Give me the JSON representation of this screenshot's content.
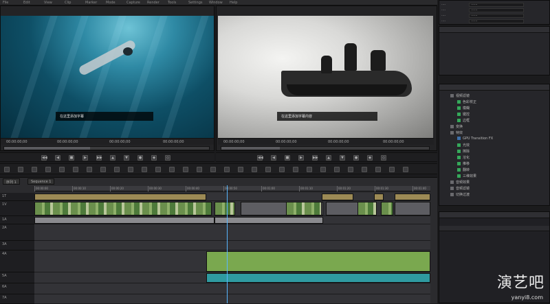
{
  "app": {
    "menu": [
      "File",
      "Edit",
      "View",
      "Clip",
      "Marker",
      "Mode",
      "Capture",
      "Render",
      "Tools",
      "Settings",
      "Window",
      "Help"
    ]
  },
  "source_monitor": {
    "subtitle": "在这里添加字幕",
    "timecodes": [
      "00:00:00;00",
      "00:00:00;00",
      "00:00:00;00",
      "00:00:00;00"
    ],
    "scrub_progress": 0.42
  },
  "record_monitor": {
    "subtitle": "在这里添加字幕内容",
    "timecodes": [
      "00:00:00;00",
      "00:00:00;00",
      "00:00:00;00",
      "00:00:00;00"
    ],
    "scrub_progress": 0.28
  },
  "transport": {
    "source_controls": [
      "◀◀",
      "◀",
      "■",
      "▶",
      "▶▶",
      "▲",
      "▼",
      "●",
      "◆",
      "◇"
    ],
    "record_controls": [
      "◀◀",
      "◀",
      "■",
      "▶",
      "▶▶",
      "▲",
      "▼",
      "●",
      "◆",
      "◇"
    ]
  },
  "properties_panel": {
    "rows": [
      {
        "key": "····",
        "value": "······"
      },
      {
        "key": "····",
        "value": "······"
      },
      {
        "key": "····",
        "value": "······"
      },
      {
        "key": "····",
        "value": "······"
      }
    ]
  },
  "effects_tree": {
    "items": [
      {
        "label": "视频滤镜",
        "indent": 1,
        "icon": "gray"
      },
      {
        "label": "色彩校正",
        "indent": 2,
        "icon": "green"
      },
      {
        "label": "模糊",
        "indent": 2,
        "icon": "green"
      },
      {
        "label": "键控",
        "indent": 2,
        "icon": "green"
      },
      {
        "label": "边框",
        "indent": 2,
        "icon": "green"
      },
      {
        "label": "变换",
        "indent": 1,
        "icon": "gray"
      },
      {
        "label": "特效",
        "indent": 1,
        "icon": "gray"
      },
      {
        "label": "GPU Transition FX",
        "indent": 2,
        "icon": "blue"
      },
      {
        "label": "光效",
        "indent": 2,
        "icon": "green"
      },
      {
        "label": "擦除",
        "indent": 2,
        "icon": "green"
      },
      {
        "label": "溶化",
        "indent": 2,
        "icon": "green"
      },
      {
        "label": "推移",
        "indent": 2,
        "icon": "green"
      },
      {
        "label": "翻转",
        "indent": 2,
        "icon": "green"
      },
      {
        "label": "三维效果",
        "indent": 2,
        "icon": "green"
      },
      {
        "label": "音频效果",
        "indent": 1,
        "icon": "gray"
      },
      {
        "label": "音频滤镜",
        "indent": 1,
        "icon": "gray"
      },
      {
        "label": "切换过渡",
        "indent": 1,
        "icon": "gray"
      }
    ]
  },
  "timeline": {
    "tabs": [
      "序列 1",
      "Sequence 1"
    ],
    "ruler_labels": [
      "00:00:00",
      "00:00:10",
      "00:00:20",
      "00:00:30",
      "00:00:40",
      "00:00:50",
      "00:01:00",
      "00:01:10",
      "00:01:20",
      "00:01:30",
      "00:01:40"
    ],
    "tracks": [
      "1T",
      "1V",
      "1A",
      "2A",
      "3A",
      "4A",
      "5A",
      "6A",
      "7A"
    ]
  },
  "watermark": {
    "text": "演艺吧",
    "sub": "yanyi8.com"
  }
}
